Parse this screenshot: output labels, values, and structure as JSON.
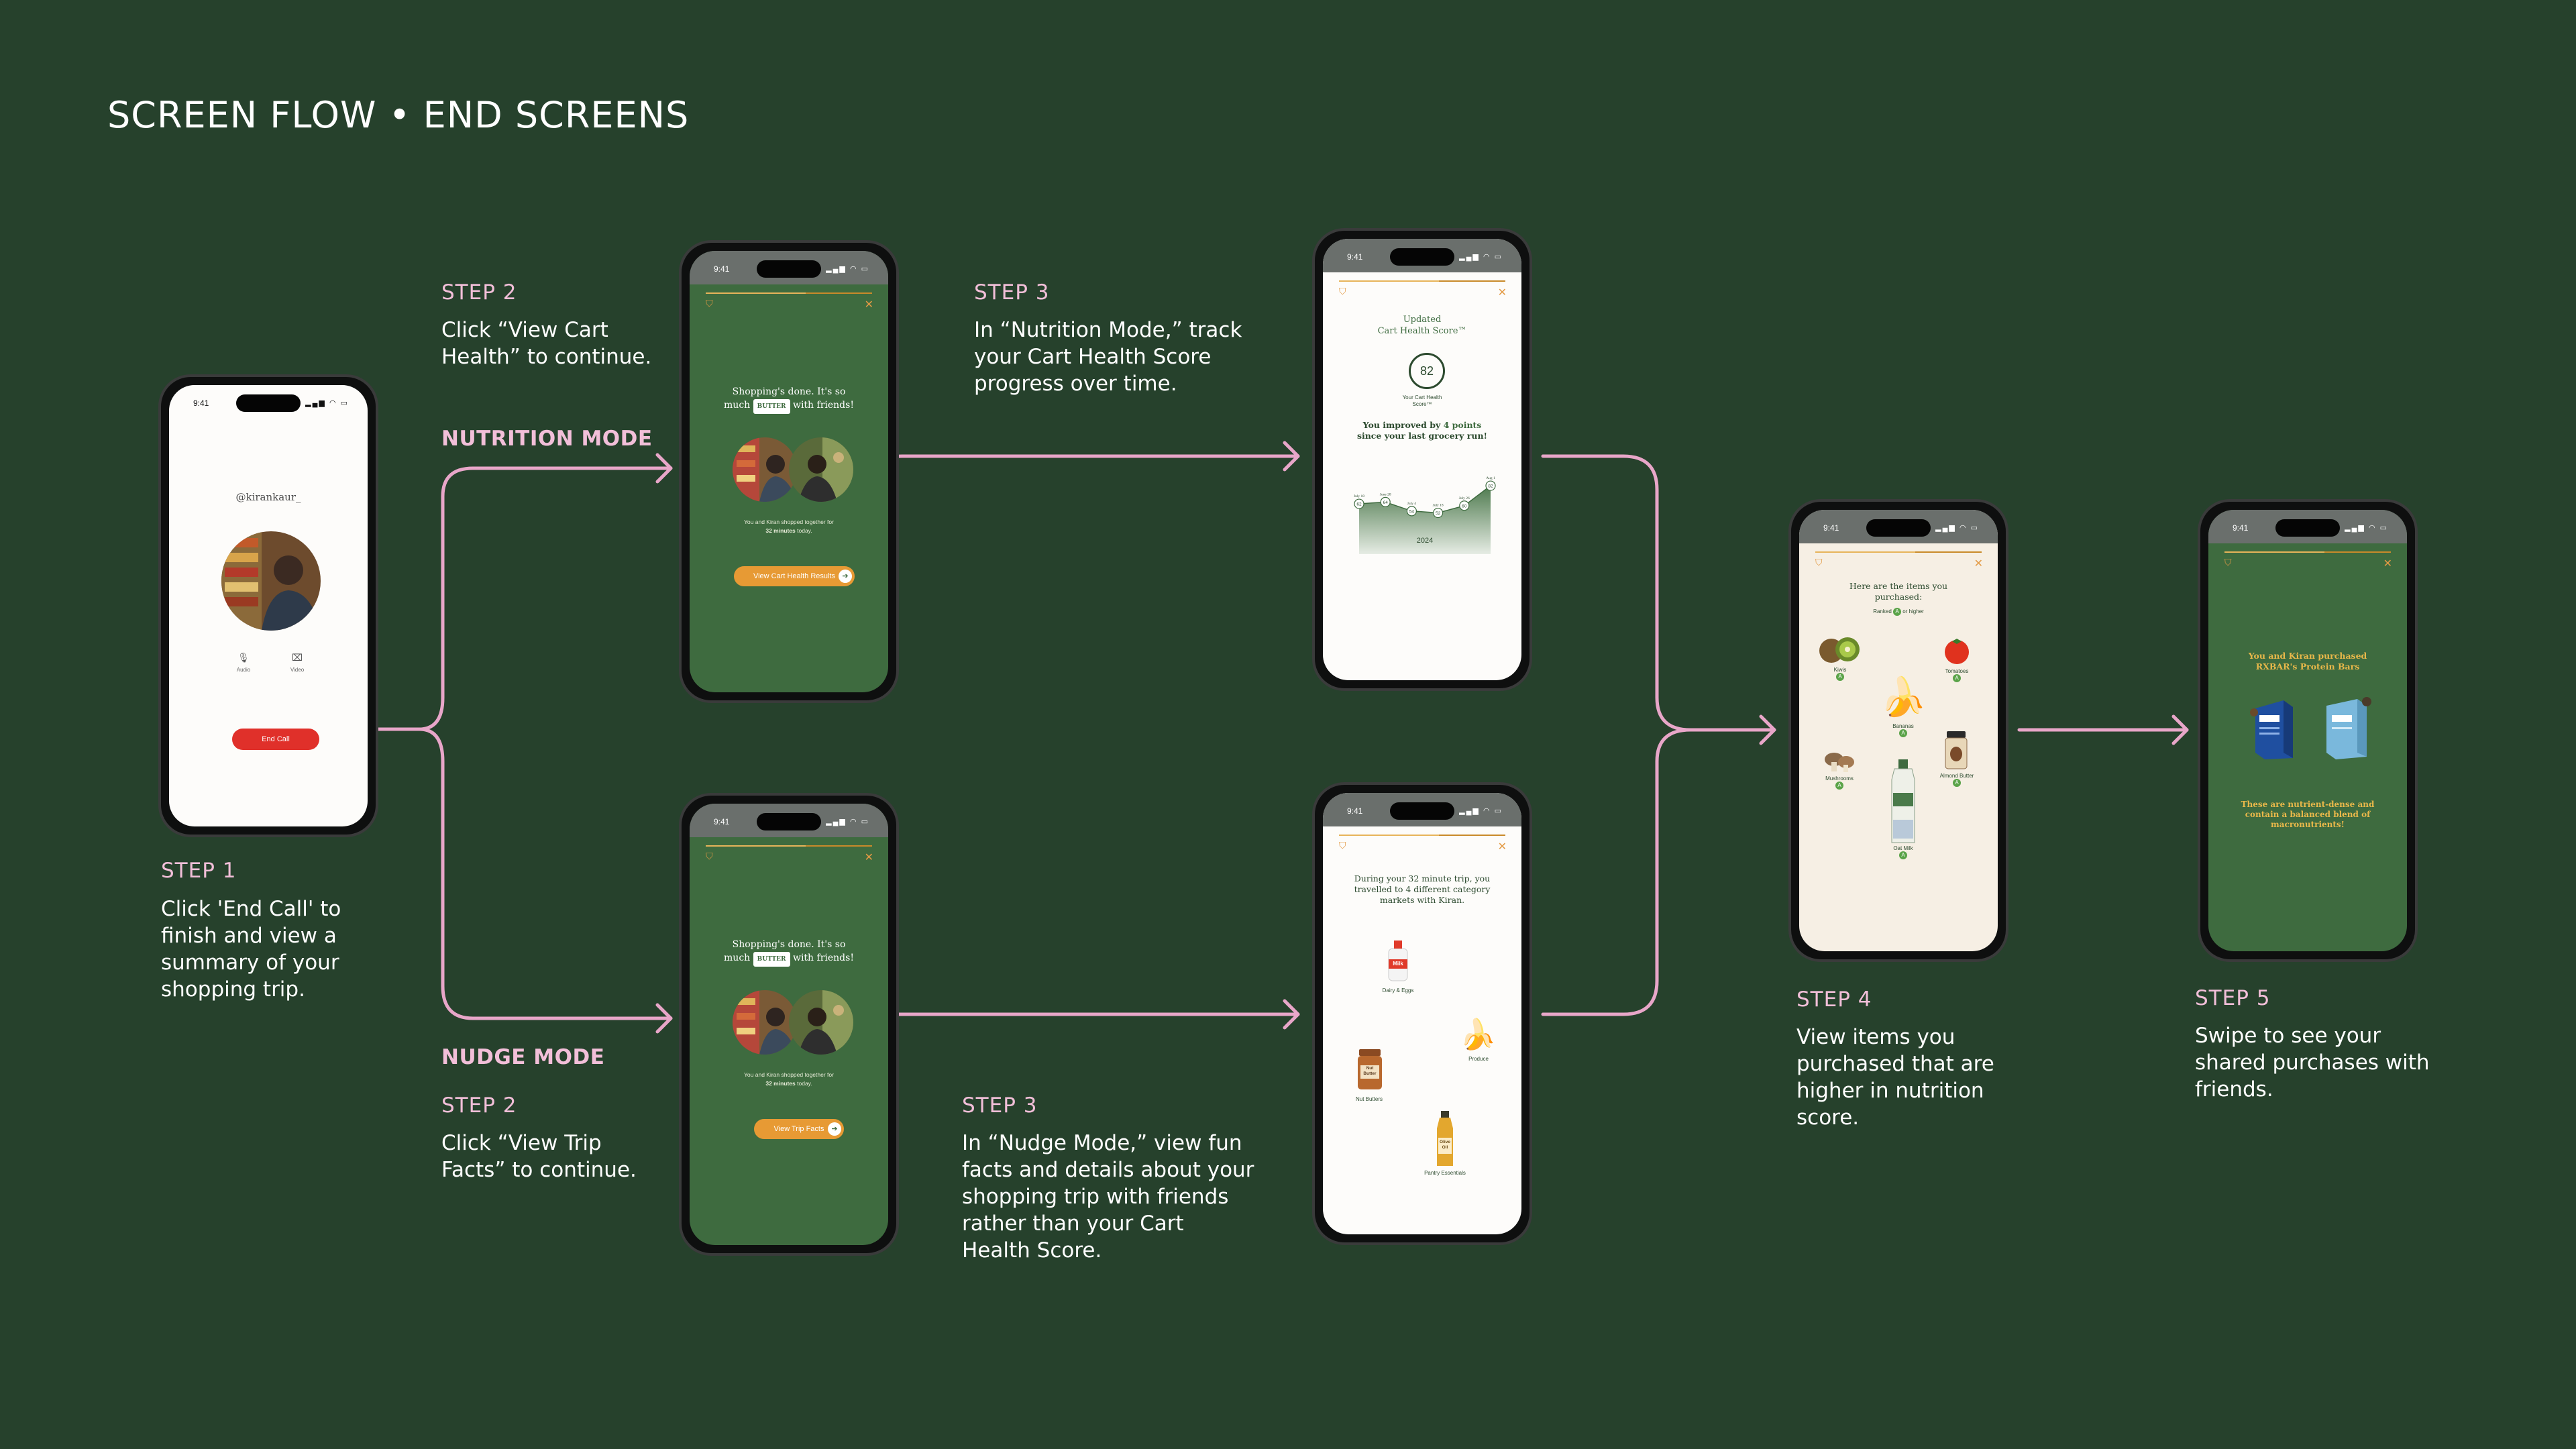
{
  "title": "SCREEN FLOW • END SCREENS",
  "colors": {
    "background": "#26412c",
    "accent_pink": "#f2bfd9",
    "phone_green": "#3e6b3f",
    "orange": "#e79a34",
    "end_call_red": "#e0302a",
    "cream": "#f6efe4"
  },
  "steps": {
    "step1": {
      "head": "STEP 1",
      "desc": "Click 'End Call' to finish and view a summary of your shopping trip."
    },
    "nutrition_mode": "NUTRITION MODE",
    "nudge_mode": "NUDGE MODE",
    "step2_top": {
      "head": "STEP 2",
      "desc": "Click “View Cart Health” to continue."
    },
    "step3_top": {
      "head": "STEP 3",
      "desc": "In “Nutrition Mode,” track your Cart Health Score progress over time."
    },
    "step2_bottom": {
      "head": "STEP 2",
      "desc": "Click “View Trip Facts” to continue."
    },
    "step3_bottom": {
      "head": "STEP 3",
      "desc": "In “Nudge Mode,” view fun facts and details about your shopping trip with friends rather than your Cart Health Score."
    },
    "step4": {
      "head": "STEP 4",
      "desc": "View items you purchased that are higher in nutrition score."
    },
    "step5": {
      "head": "STEP 5",
      "desc": "Swipe to see your shared purchases with friends."
    }
  },
  "phones": {
    "time": "9:41",
    "call": {
      "username": "@kirankaur_",
      "audio_label": "Audio",
      "video_label": "Video",
      "end_call": "End Call"
    },
    "summary": {
      "line1": "Shopping's done. It's so",
      "much": "much",
      "butter": "BUTTER",
      "with_friends": "with friends!",
      "together": "You and Kiran shopped together for",
      "minutes": "32 minutes",
      "today": "today.",
      "btn_nutrition": "View Cart Health Results",
      "btn_nudge": "View Trip Facts"
    },
    "score": {
      "title1": "Updated",
      "title2": "Cart Health Score™",
      "value": "82",
      "label1": "Your Cart Health",
      "label2": "Score™",
      "improved_a": "You improved by ",
      "improved_b": "4 points",
      "improved_c": "since your last grocery run!",
      "year": "2024",
      "dates": [
        "July 18",
        "June 28",
        "July 4",
        "July 18",
        "July 26",
        "Aug 1"
      ]
    },
    "trip": {
      "text": "During your 32 minute trip, you travelled to 4 different category markets with Kiran.",
      "milk_label": "Milk",
      "dairy": "Dairy & Eggs",
      "produce": "Produce",
      "nut_label": "Nut Butter",
      "nut": "Nut Butters",
      "oil_label": "Olive Oil",
      "pantry": "Pantry Essentials"
    },
    "items": {
      "title": "Here are the items you purchased:",
      "ranked": "Ranked",
      "grade": "A",
      "or_higher": "or higher",
      "kiwis": "Kiwis",
      "tomatoes": "Tomatoes",
      "bananas": "Bananas",
      "mushrooms": "Mushrooms",
      "almond": "Almond Butter",
      "oat": "Oat Milk"
    },
    "shared": {
      "title": "You and Kiran purchased RXBAR's Protein Bars",
      "body": "These are nutrient-dense and contain a balanced blend of macronutrients!"
    }
  },
  "chart_data": {
    "type": "line",
    "title": "",
    "x": [
      "July 18",
      "June 28",
      "July 4",
      "July 18",
      "July 26",
      "Aug 1"
    ],
    "series": [
      {
        "values": [
          62,
          64,
          54,
          52,
          60,
          82
        ]
      }
    ]
  }
}
